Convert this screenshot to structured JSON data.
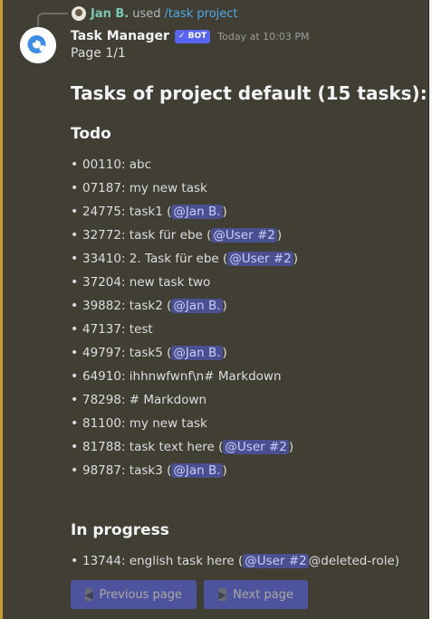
{
  "reply": {
    "user": "Jan B.",
    "used": "used",
    "command": "/task project"
  },
  "header": {
    "name": "Task Manager",
    "bot_tag": "✓ BOT",
    "time": "Today at 10:03 PM"
  },
  "page_label": "Page 1/1",
  "title": "Tasks of project default (15 tasks):",
  "sections": {
    "todo": {
      "heading": "Todo",
      "items": [
        {
          "text": "00110: abc",
          "mention": "",
          "after": ""
        },
        {
          "text": "07187: my new task",
          "mention": "",
          "after": ""
        },
        {
          "text": "24775: task1 (",
          "mention": "@Jan B.",
          "after": ")"
        },
        {
          "text": "32772: task für ebe (",
          "mention": "@User #2",
          "after": ")"
        },
        {
          "text": "33410: 2. Task für ebe (",
          "mention": "@User #2",
          "after": ")"
        },
        {
          "text": "37204: new task two",
          "mention": "",
          "after": ""
        },
        {
          "text": "39882: task2 (",
          "mention": "@Jan B.",
          "after": ")"
        },
        {
          "text": "47137: test",
          "mention": "",
          "after": ""
        },
        {
          "text": "49797: task5 (",
          "mention": "@Jan B.",
          "after": ")"
        },
        {
          "text": "64910: ihhnwfwnf\\n# Markdown",
          "mention": "",
          "after": ""
        },
        {
          "text": "78298: # Markdown",
          "mention": "",
          "after": ""
        },
        {
          "text": "81100: my new task",
          "mention": "",
          "after": ""
        },
        {
          "text": "81788: task text here (",
          "mention": "@User #2",
          "after": ")"
        },
        {
          "text": "98787: task3 (",
          "mention": "@Jan B.",
          "after": ")"
        }
      ]
    },
    "in_progress": {
      "heading": "In progress",
      "items": [
        {
          "text": "13744: english task here (",
          "mention": "@User #2",
          "after": "@deleted-role)"
        }
      ]
    }
  },
  "buttons": {
    "prev_label": "Previous page",
    "next_label": "Next page"
  },
  "colors": {
    "accent": "#5865f2",
    "mention_bg": "#4a4f8f",
    "message_bg": "#413e34",
    "highlight_bar": "#c99b2c"
  }
}
